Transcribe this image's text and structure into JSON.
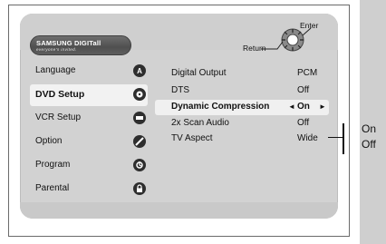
{
  "brand": {
    "name": "SAMSUNG DIGITall",
    "tagline": "everyone's invited."
  },
  "controls": {
    "enter": "Enter",
    "return": "Return"
  },
  "menu_left": [
    {
      "label": "Language",
      "icon": "language-icon",
      "selected": false
    },
    {
      "label": "DVD Setup",
      "icon": "dvd-disc-icon",
      "selected": true
    },
    {
      "label": "VCR Setup",
      "icon": "vcr-tape-icon",
      "selected": false
    },
    {
      "label": "Option",
      "icon": "option-icon",
      "selected": false
    },
    {
      "label": "Program",
      "icon": "program-icon",
      "selected": false
    },
    {
      "label": "Parental",
      "icon": "lock-icon",
      "selected": false
    }
  ],
  "menu_right": [
    {
      "label": "Digital Output",
      "value": "PCM",
      "selected": false
    },
    {
      "label": "DTS",
      "value": "Off",
      "selected": false
    },
    {
      "label": "Dynamic Compression",
      "value": "On",
      "selected": true
    },
    {
      "label": "2x Scan Audio",
      "value": "Off",
      "selected": false
    },
    {
      "label": "TV Aspect",
      "value": "Wide",
      "selected": false
    }
  ],
  "selection_arrows": {
    "left": "◄",
    "right": "►"
  },
  "callout_options": [
    "On",
    "Off"
  ],
  "colors": {
    "screen_bg": "#d2d2d2",
    "highlight": "#f2f2f2",
    "brand_pill": "#5a5a5a"
  }
}
